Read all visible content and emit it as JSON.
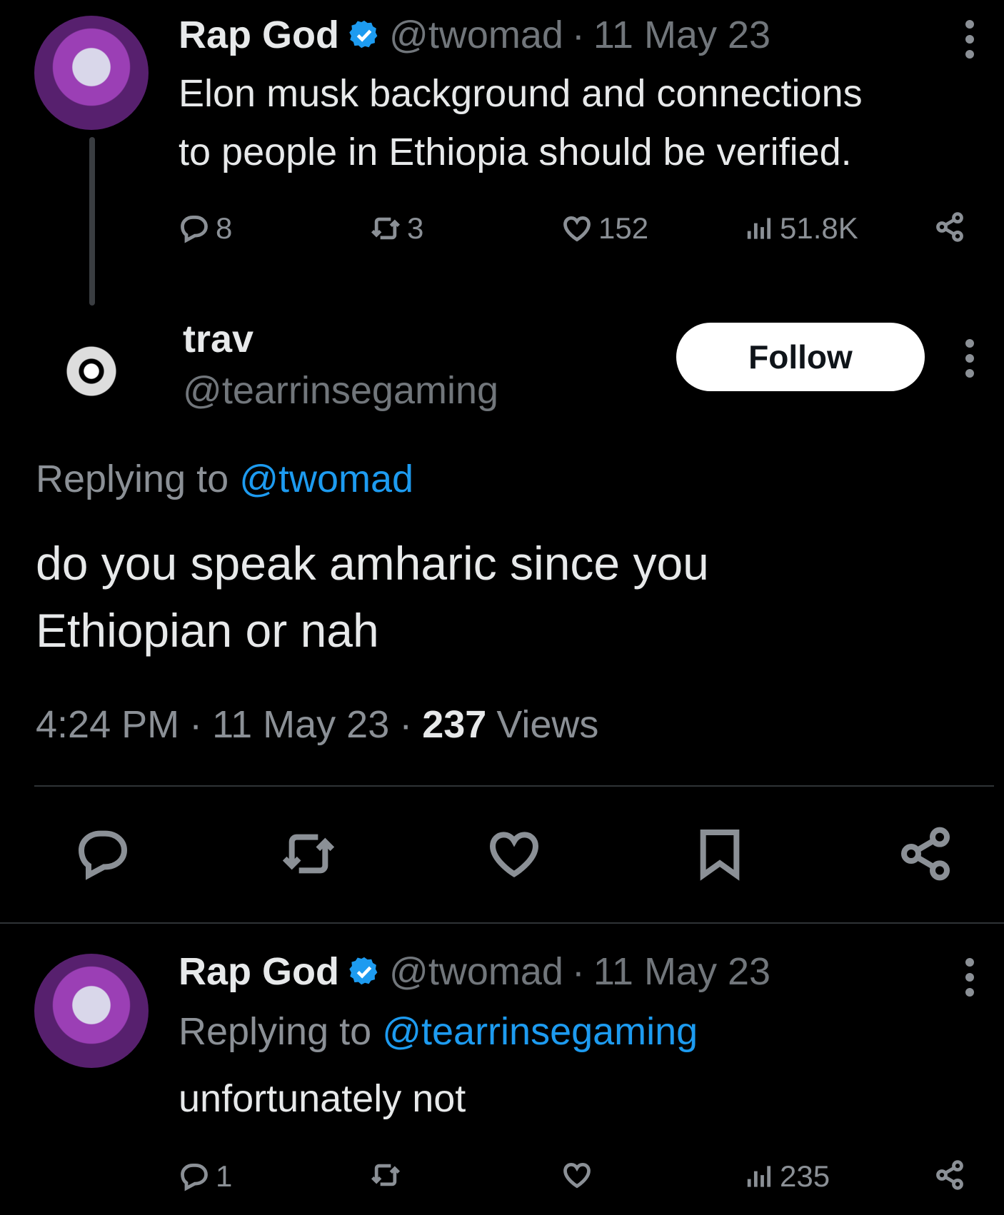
{
  "tweet1": {
    "name": "Rap God",
    "handle": "@twomad",
    "separator": "·",
    "date": "11 May 23",
    "text_line1": "Elon musk background and connections",
    "text_line2": "to people in Ethiopia should be verified.",
    "stats": {
      "replies": "8",
      "retweets": "3",
      "likes": "152",
      "views": "51.8K"
    }
  },
  "main_tweet": {
    "name": "trav",
    "handle": "@tearrinsegaming",
    "follow_label": "Follow",
    "replying_prefix": "Replying to",
    "replying_to": "@twomad",
    "text_line1": "do you speak amharic since you",
    "text_line2": "Ethiopian or nah",
    "time": "4:24 PM",
    "separator": "·",
    "date": "11 May 23",
    "views_count": "237",
    "views_label": "Views"
  },
  "reply": {
    "name": "Rap God",
    "handle": "@twomad",
    "separator": "·",
    "date": "11 May 23",
    "replying_prefix": "Replying to",
    "replying_to": "@tearrinsegaming",
    "text": "unfortunately not",
    "stats": {
      "replies": "1",
      "views": "235"
    }
  },
  "colors": {
    "background": "#000000",
    "text": "#e7e9ea",
    "muted": "#8b9096",
    "link": "#1d9bf0",
    "verified": "#1d9bf0"
  }
}
